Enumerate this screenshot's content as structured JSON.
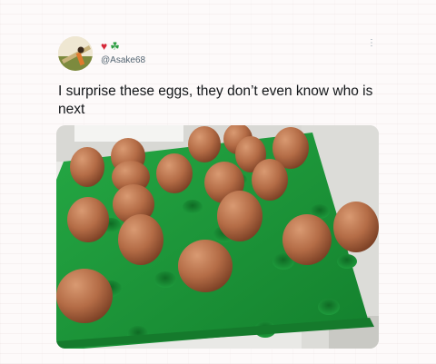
{
  "tweet": {
    "name_emojis": [
      "♥",
      "☘"
    ],
    "handle": "@Asake68",
    "text": "I surprise these eggs, they don’t even know who is next",
    "more_icon": "⋮"
  },
  "icons": {
    "avatar": "avatar-photo",
    "more": "more-options-icon"
  },
  "colors": {
    "tray": "#1e9b3c",
    "egg": "#b06a45",
    "handle": "#536471",
    "text": "#14171a"
  }
}
